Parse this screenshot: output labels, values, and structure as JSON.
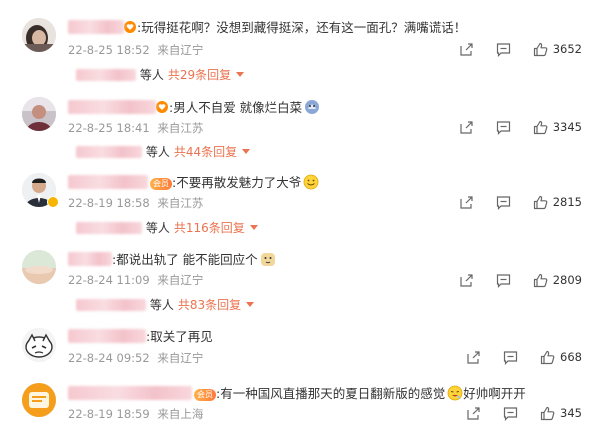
{
  "colors": {
    "accent": "#eb7350",
    "muted": "#999999",
    "text": "#333333",
    "blurred_name": "#f5c8cf"
  },
  "comments": [
    {
      "id": 1,
      "text": ":玩得挺花啊？没想到藏得挺深，还有这一面孔？满嘴谎话！",
      "date": "22-8-25 18:52",
      "location": "来自辽宁",
      "likes": "3652",
      "reply_who": "等人",
      "reply_count": "共29条回复"
    },
    {
      "id": 2,
      "text": ":男人不自爱 就像烂白菜",
      "date": "22-8-25 18:41",
      "location": "来自江苏",
      "likes": "3345",
      "reply_who": "等人",
      "reply_count": "共44条回复"
    },
    {
      "id": 3,
      "text": ":不要再散发魅力了大爷",
      "date": "22-8-19 18:58",
      "location": "来自江苏",
      "likes": "2815",
      "reply_who": "等人",
      "reply_count": "共116条回复"
    },
    {
      "id": 4,
      "text": ":都说出轨了 能不能回应个",
      "date": "22-8-24 11:09",
      "location": "来自辽宁",
      "likes": "2809",
      "reply_who": "等人",
      "reply_count": "共83条回复"
    },
    {
      "id": 5,
      "text": ":取关了再见",
      "date": "22-8-24 09:52",
      "location": "来自辽宁",
      "likes": "668"
    },
    {
      "id": 6,
      "text": ":有一种国风直播那天的夏日翻新版的感觉",
      "text2": "好帅啊开开",
      "date": "22-8-19 18:59",
      "location": "来自上海",
      "likes": "345"
    }
  ],
  "icons": [
    "share-icon",
    "comment-icon",
    "like-icon",
    "heart-badge-icon",
    "vip-badge-icon"
  ]
}
